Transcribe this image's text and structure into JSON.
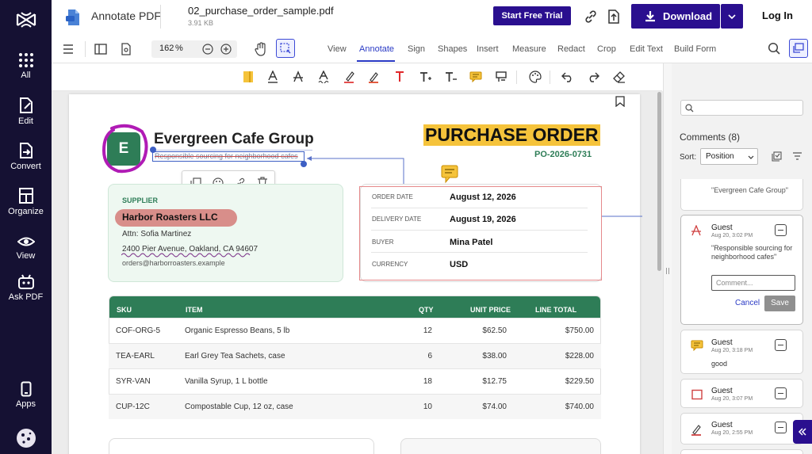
{
  "rail": {
    "items": [
      {
        "label": "All"
      },
      {
        "label": "Edit"
      },
      {
        "label": "Convert"
      },
      {
        "label": "Organize"
      },
      {
        "label": "View"
      },
      {
        "label": "Ask PDF"
      },
      {
        "label": "Apps"
      }
    ]
  },
  "header": {
    "app_name": "Annotate PDF",
    "file_name": "02_purchase_order_sample.pdf",
    "file_size": "3.91 KB",
    "trial_button": "Start Free Trial",
    "download_button": "Download",
    "login_link": "Log In"
  },
  "toolbar": {
    "zoom_value": "162",
    "zoom_unit": "%",
    "tabs": [
      "View",
      "Annotate",
      "Sign",
      "Shapes",
      "Insert",
      "Measure",
      "Redact",
      "Crop",
      "Edit Text",
      "Build Form"
    ],
    "active_tab": "Annotate"
  },
  "document": {
    "company_initial": "E",
    "company_name": "Evergreen Cafe Group",
    "tagline": "Responsible sourcing for neighborhood cafes",
    "doc_title": "PURCHASE ORDER",
    "po_number": "PO-2026-0731",
    "supplier_heading": "SUPPLIER",
    "supplier_name": "Harbor Roasters LLC",
    "supplier_attn": "Attn: Sofia Martinez",
    "supplier_address": "2400 Pier Avenue, Oakland, CA 94607",
    "supplier_email": "orders@harborroasters.example",
    "details": [
      {
        "label": "ORDER DATE",
        "value": "August 12, 2026"
      },
      {
        "label": "DELIVERY DATE",
        "value": "August 19, 2026"
      },
      {
        "label": "BUYER",
        "value": "Mina Patel"
      },
      {
        "label": "CURRENCY",
        "value": "USD"
      }
    ],
    "table_headers": {
      "sku": "SKU",
      "item": "ITEM",
      "qty": "QTY",
      "unit_price": "UNIT PRICE",
      "line_total": "LINE TOTAL"
    },
    "table_rows": [
      {
        "sku": "COF-ORG-5",
        "item": "Organic Espresso Beans, 5 lb",
        "qty": "12",
        "unit_price": "$62.50",
        "line_total": "$750.00"
      },
      {
        "sku": "TEA-EARL",
        "item": "Earl Grey Tea Sachets, case",
        "qty": "6",
        "unit_price": "$38.00",
        "line_total": "$228.00"
      },
      {
        "sku": "SYR-VAN",
        "item": "Vanilla Syrup, 1 L bottle",
        "qty": "18",
        "unit_price": "$12.75",
        "line_total": "$229.50"
      },
      {
        "sku": "CUP-12C",
        "item": "Compostable Cup, 12 oz, case",
        "qty": "10",
        "unit_price": "$74.00",
        "line_total": "$740.00"
      }
    ]
  },
  "comments": {
    "title": "Comments (8)",
    "sort_label": "Sort:",
    "sort_value": "Position",
    "partial_quote": "\"Evergreen Cafe Group\"",
    "active": {
      "author": "Guest",
      "time": "Aug 20, 3:02 PM",
      "quote": "\"Responsible sourcing for neighborhood cafes\"",
      "input_placeholder": "Comment...",
      "cancel": "Cancel",
      "save": "Save"
    },
    "items": [
      {
        "author": "Guest",
        "time": "Aug 20, 3:18 PM",
        "text": "good"
      },
      {
        "author": "Guest",
        "time": "Aug 20, 3:07 PM"
      },
      {
        "author": "Guest",
        "time": "Aug 20, 2:55 PM"
      }
    ]
  },
  "colors": {
    "rail_bg": "#151133",
    "brand_purple": "#2a0f8f",
    "green": "#2e7d57",
    "highlight_yellow": "#f5c33b",
    "annotation_magenta": "#b01bb5"
  }
}
